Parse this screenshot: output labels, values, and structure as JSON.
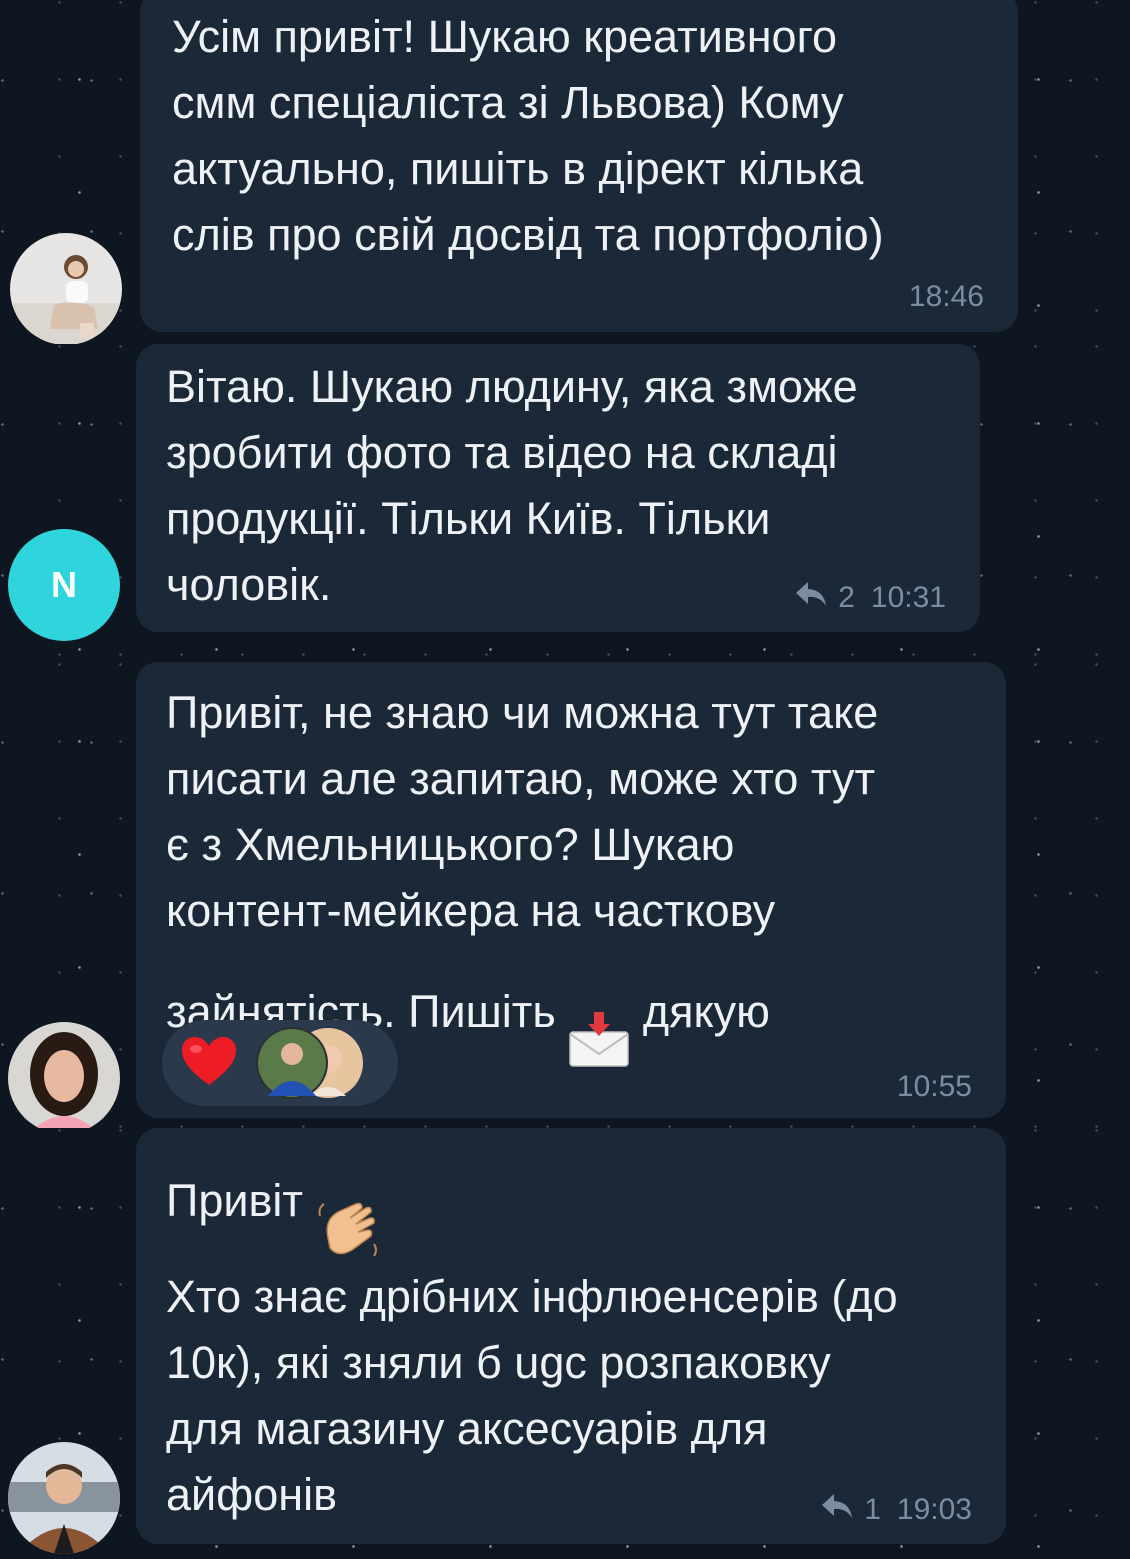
{
  "messages": [
    {
      "text": "Усім привіт! Шукаю креативного\nсмм спеціаліста зі Львова) Кому\nактуально, пишіть в дірект кілька\nслів про свій досвід та портфоліо)",
      "time": "18:46"
    },
    {
      "avatar_letter": "N",
      "text": "Вітаю. Шукаю людину, яка зможе\nзробити фото та відео на складі\nпродукції. Тільки Київ. Тільки\nчоловік.",
      "replies": "2",
      "time": "10:31"
    },
    {
      "text": "Привіт, не знаю чи можна тут таке\nписати але запитаю, може хто тут\nє з Хмельницького? Шукаю\nконтент-мейкера на часткову\nзайнятість. Пишіть",
      "text_after_emoji": "дякую",
      "emoji": "envelope-with-arrow-icon",
      "reaction": "red-heart-icon",
      "time": "10:55"
    },
    {
      "text_greeting": "Привіт",
      "emoji": "waving-hand-icon",
      "text": "Хто знає дрібних інфлюенсерів (до\n10к), які зняли б ugc розпаковку\nдля магазину аксесуарів для\nайфонів",
      "replies": "1",
      "time": "19:03"
    }
  ],
  "colors": {
    "background": "#0e1621",
    "bubble": "#1b2838",
    "text": "#eef2f6",
    "meta": "#7d8da1",
    "avatar_n": "#2fd5dc",
    "reaction_pill": "#2a394b"
  }
}
